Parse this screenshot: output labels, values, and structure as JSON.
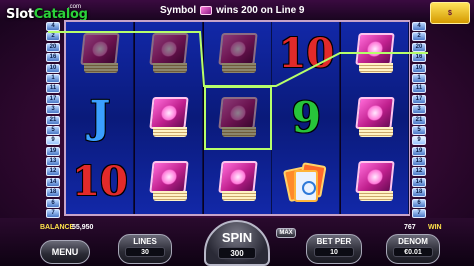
{
  "branding": {
    "logo_main": "Slot",
    "logo_accent": "Catalog",
    "logo_com": ".com",
    "corner_logo_icon": "gold-coins-logo"
  },
  "message": {
    "prefix": "Symbol",
    "symbol_icon": "book-icon",
    "text": "wins 200 on Line 9"
  },
  "paylines": {
    "left": [
      "4",
      "2",
      "20",
      "16",
      "10",
      "1",
      "11",
      "17",
      "3",
      "21",
      "5",
      "9",
      "19",
      "13",
      "12",
      "14",
      "18",
      "6",
      "7",
      "15",
      "8"
    ],
    "right": [
      "4",
      "2",
      "20",
      "16",
      "10",
      "1",
      "11",
      "17",
      "3",
      "21",
      "5",
      "9",
      "19",
      "13",
      "12",
      "14",
      "18",
      "6",
      "7",
      "15",
      "8"
    ],
    "active_line": "9"
  },
  "reels": [
    [
      {
        "symbol": "book",
        "dim": true
      },
      {
        "symbol": "J"
      },
      {
        "symbol": "10"
      }
    ],
    [
      {
        "symbol": "book",
        "dim": true
      },
      {
        "symbol": "book"
      },
      {
        "symbol": "book"
      }
    ],
    [
      {
        "symbol": "book",
        "dim": true
      },
      {
        "symbol": "book",
        "dim": true,
        "highlight": true
      },
      {
        "symbol": "book"
      }
    ],
    [
      {
        "symbol": "10"
      },
      {
        "symbol": "9"
      },
      {
        "symbol": "scatter-cards"
      }
    ],
    [
      {
        "symbol": "book"
      },
      {
        "symbol": "book"
      },
      {
        "symbol": "book"
      }
    ]
  ],
  "highlights": [
    "reel2-row0",
    "reel1-row1",
    "reel2-row1",
    "reel3-row0"
  ],
  "controls": {
    "balance_label": "BALANCE",
    "balance_value": "55,950",
    "win_value": "767",
    "win_label": "WIN",
    "menu_label": "MENU",
    "lines_label": "LINES",
    "lines_value": "30",
    "spin_label": "SPIN",
    "spin_value": "300",
    "max_label": "MAX",
    "bet_per_label": "BET PER",
    "bet_per_value": "10",
    "denom_label": "DENOM",
    "denom_value": "€0.01"
  },
  "colors": {
    "reel_blue": "#0a1a7a",
    "payline": "#b7ff6a",
    "frame": "#c7a3c9"
  }
}
